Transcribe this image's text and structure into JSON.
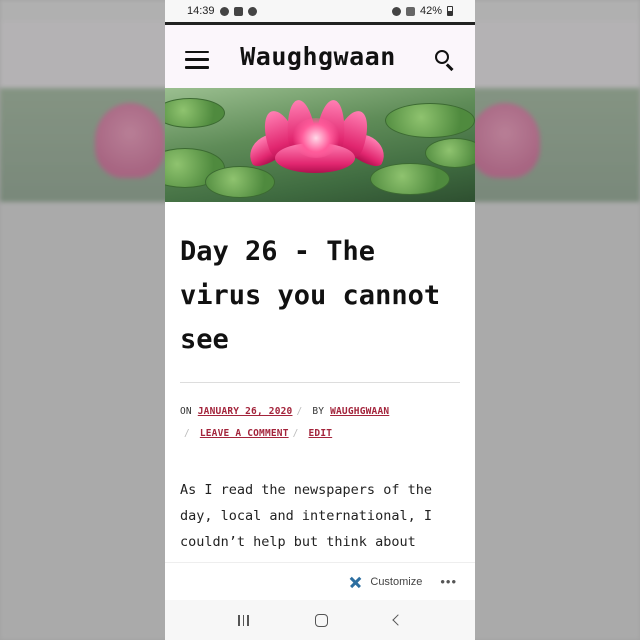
{
  "status_bar": {
    "time": "14:39",
    "battery": "42%"
  },
  "header": {
    "site_title": "Waughgwaan"
  },
  "post": {
    "title": "Day 26 - The virus you cannot see",
    "meta": {
      "on_label": "On",
      "date": "January 26, 2020",
      "by_label": "By",
      "author": "waughgwaan",
      "comment_link": "Leave a comment",
      "edit_link": "Edit"
    },
    "body": "As I read the newspapers of the day, local and international, I couldn’t help but think about"
  },
  "customize_bar": {
    "label": "Customize",
    "more": "•••"
  },
  "colors": {
    "link": "#a3243b",
    "header_bg": "#fbf6fb",
    "flower": "#e1266f"
  }
}
